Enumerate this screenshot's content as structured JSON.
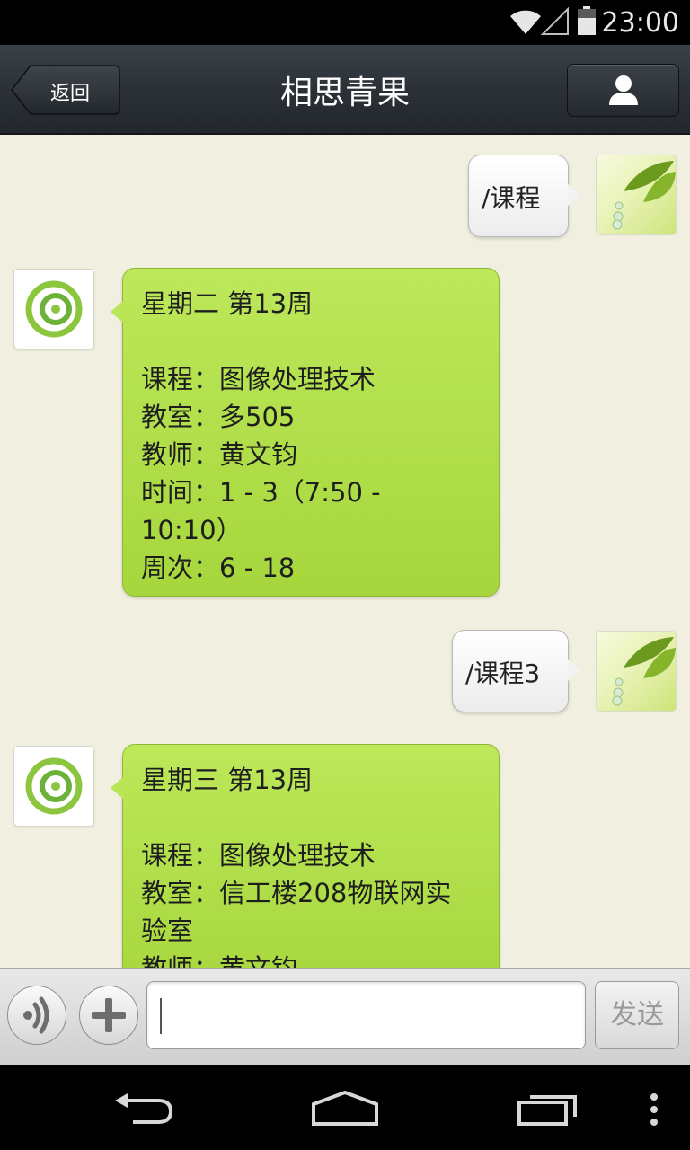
{
  "status_bar": {
    "time": "23:00"
  },
  "title_bar": {
    "back_label": "返回",
    "title": "相思青果"
  },
  "messages": [
    {
      "from": "user",
      "text": "/课程"
    },
    {
      "from": "bot",
      "lines": [
        "星期二 第13周",
        "",
        "课程：图像处理技术",
        "教室：多505",
        "教师：黄文钧",
        "时间：1 - 3（7:50 -",
        "10:10）",
        "周次：6 - 18"
      ]
    },
    {
      "from": "user",
      "text": "/课程3"
    },
    {
      "from": "bot",
      "lines": [
        "星期三 第13周",
        "",
        "课程：图像处理技术",
        "教室：信工楼208物联网实",
        "验室",
        "教师：黄文钧"
      ]
    }
  ],
  "input_bar": {
    "message_value": "",
    "send_label": "发送"
  },
  "colors": {
    "chat_bg": "#f1efdf",
    "bot_bubble": "#b2de4a",
    "titlebar": "#2b3137"
  }
}
